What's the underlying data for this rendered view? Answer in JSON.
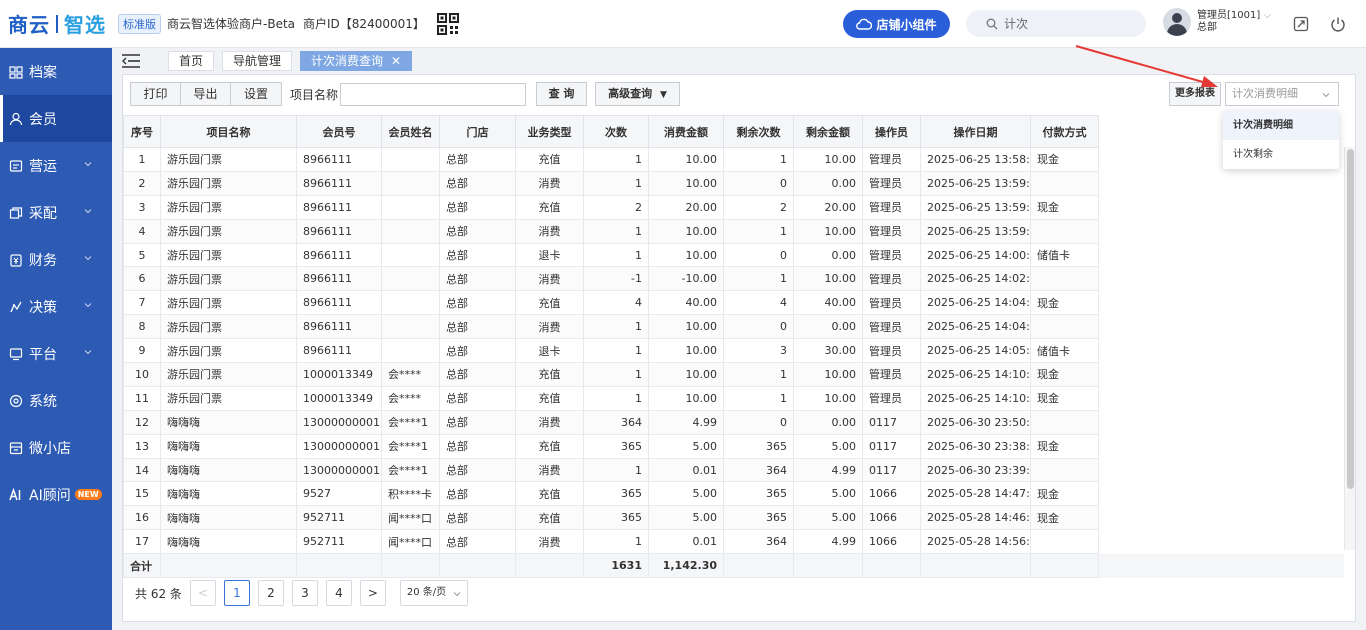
{
  "brand": {
    "left": "商云",
    "right": "智选",
    "edition": "标准版",
    "merchant": "商云智选体验商户-Beta",
    "merchant_id": "商户ID【82400001】"
  },
  "header": {
    "widget_label": "店铺小组件",
    "search_value": "计次",
    "user_name": "管理员[1001]",
    "user_store": "总部"
  },
  "sidebar": {
    "items": [
      {
        "label": "档案",
        "icon": "archive-icon",
        "chevron": false
      },
      {
        "label": "会员",
        "icon": "member-icon",
        "chevron": false,
        "active": true
      },
      {
        "label": "营运",
        "icon": "operation-icon",
        "chevron": true
      },
      {
        "label": "采配",
        "icon": "purchase-icon",
        "chevron": true
      },
      {
        "label": "财务",
        "icon": "finance-icon",
        "chevron": true
      },
      {
        "label": "决策",
        "icon": "decision-icon",
        "chevron": true
      },
      {
        "label": "平台",
        "icon": "platform-icon",
        "chevron": true
      },
      {
        "label": "系统",
        "icon": "system-icon",
        "chevron": false
      },
      {
        "label": "微小店",
        "icon": "shop-icon",
        "chevron": false
      },
      {
        "label": "AI顾问",
        "icon": "ai-icon",
        "chevron": false,
        "badge": "NEW"
      }
    ]
  },
  "tabs": [
    {
      "label": "首页"
    },
    {
      "label": "导航管理"
    },
    {
      "label": "计次消费查询",
      "active": true
    }
  ],
  "toolbar": {
    "print": "打印",
    "export": "导出",
    "settings": "设置",
    "item_name_label": "项目名称",
    "item_name_value": "",
    "query": "查 询",
    "advanced": "高级查询",
    "more_reports": "更多报表",
    "report_select_placeholder": "计次消费明细"
  },
  "dropdown": {
    "options": [
      "计次消费明细",
      "计次剩余"
    ]
  },
  "table": {
    "columns": [
      "序号",
      "项目名称",
      "会员号",
      "会员姓名",
      "门店",
      "业务类型",
      "次数",
      "消费金额",
      "剩余次数",
      "剩余金额",
      "操作员",
      "操作日期",
      "付款方式"
    ],
    "rows": [
      [
        "1",
        "游乐园门票",
        "8966111",
        "",
        "总部",
        "充值",
        "1",
        "10.00",
        "1",
        "10.00",
        "管理员",
        "2025-06-25 13:58:...",
        "现金"
      ],
      [
        "2",
        "游乐园门票",
        "8966111",
        "",
        "总部",
        "消费",
        "1",
        "10.00",
        "0",
        "0.00",
        "管理员",
        "2025-06-25 13:59:...",
        ""
      ],
      [
        "3",
        "游乐园门票",
        "8966111",
        "",
        "总部",
        "充值",
        "2",
        "20.00",
        "2",
        "20.00",
        "管理员",
        "2025-06-25 13:59:...",
        "现金"
      ],
      [
        "4",
        "游乐园门票",
        "8966111",
        "",
        "总部",
        "消费",
        "1",
        "10.00",
        "1",
        "10.00",
        "管理员",
        "2025-06-25 13:59:...",
        ""
      ],
      [
        "5",
        "游乐园门票",
        "8966111",
        "",
        "总部",
        "退卡",
        "1",
        "10.00",
        "0",
        "0.00",
        "管理员",
        "2025-06-25 14:00:...",
        "储值卡"
      ],
      [
        "6",
        "游乐园门票",
        "8966111",
        "",
        "总部",
        "消费",
        "-1",
        "-10.00",
        "1",
        "10.00",
        "管理员",
        "2025-06-25 14:02:...",
        ""
      ],
      [
        "7",
        "游乐园门票",
        "8966111",
        "",
        "总部",
        "充值",
        "4",
        "40.00",
        "4",
        "40.00",
        "管理员",
        "2025-06-25 14:04:...",
        "现金"
      ],
      [
        "8",
        "游乐园门票",
        "8966111",
        "",
        "总部",
        "消费",
        "1",
        "10.00",
        "0",
        "0.00",
        "管理员",
        "2025-06-25 14:04:...",
        ""
      ],
      [
        "9",
        "游乐园门票",
        "8966111",
        "",
        "总部",
        "退卡",
        "1",
        "10.00",
        "3",
        "30.00",
        "管理员",
        "2025-06-25 14:05:...",
        "储值卡"
      ],
      [
        "10",
        "游乐园门票",
        "1000013349",
        "会****",
        "总部",
        "充值",
        "1",
        "10.00",
        "1",
        "10.00",
        "管理员",
        "2025-06-25 14:10:...",
        "现金"
      ],
      [
        "11",
        "游乐园门票",
        "1000013349",
        "会****",
        "总部",
        "充值",
        "1",
        "10.00",
        "1",
        "10.00",
        "管理员",
        "2025-06-25 14:10:...",
        "现金"
      ],
      [
        "12",
        "嗨嗨嗨",
        "13000000001",
        "会****1",
        "总部",
        "消费",
        "364",
        "4.99",
        "0",
        "0.00",
        "0117",
        "2025-06-30 23:50:...",
        ""
      ],
      [
        "13",
        "嗨嗨嗨",
        "13000000001",
        "会****1",
        "总部",
        "充值",
        "365",
        "5.00",
        "365",
        "5.00",
        "0117",
        "2025-06-30 23:38:...",
        "现金"
      ],
      [
        "14",
        "嗨嗨嗨",
        "13000000001",
        "会****1",
        "总部",
        "消费",
        "1",
        "0.01",
        "364",
        "4.99",
        "0117",
        "2025-06-30 23:39:...",
        ""
      ],
      [
        "15",
        "嗨嗨嗨",
        "9527",
        "积****卡",
        "总部",
        "充值",
        "365",
        "5.00",
        "365",
        "5.00",
        "1066",
        "2025-05-28 14:47:...",
        "现金"
      ],
      [
        "16",
        "嗨嗨嗨",
        "952711",
        "闻****口",
        "总部",
        "充值",
        "365",
        "5.00",
        "365",
        "5.00",
        "1066",
        "2025-05-28 14:46:...",
        "现金"
      ],
      [
        "17",
        "嗨嗨嗨",
        "952711",
        "闻****口",
        "总部",
        "消费",
        "1",
        "0.01",
        "364",
        "4.99",
        "1066",
        "2025-05-28 14:56:...",
        ""
      ]
    ],
    "summary": {
      "label": "合计",
      "count": "1631",
      "amount": "1,142.30"
    }
  },
  "pager": {
    "total": "共 62 条",
    "pages": [
      "1",
      "2",
      "3",
      "4"
    ],
    "prev": "<",
    "next": ">",
    "page_size": "20 条/页"
  },
  "colors": {
    "sidebar": "#2d5bb3",
    "accent": "#2b5fd9",
    "tab_active": "#7ea7e3",
    "arrow": "#e53935"
  }
}
